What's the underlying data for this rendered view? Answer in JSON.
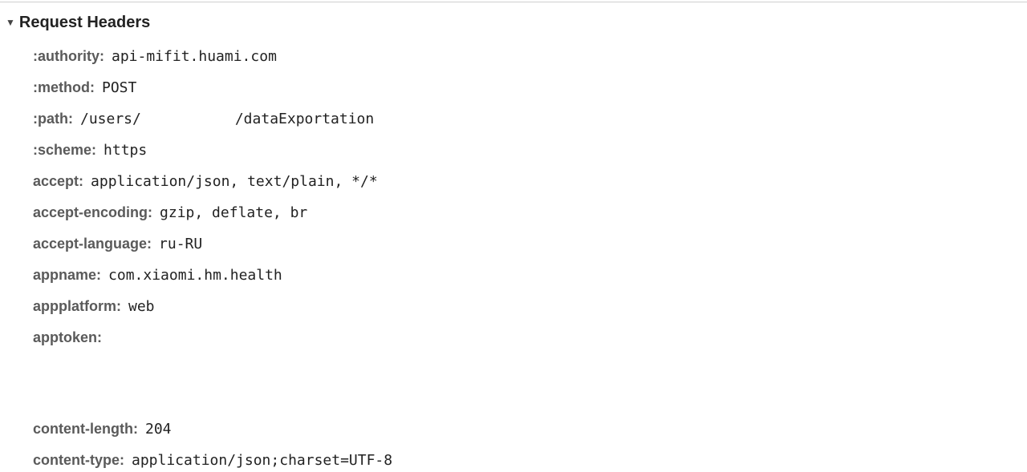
{
  "section": {
    "title": "Request Headers",
    "toggle_icon": "triangle-down-icon",
    "expanded": true
  },
  "headers": [
    {
      "key": ":authority:",
      "value": "api-mifit.huami.com"
    },
    {
      "key": ":method:",
      "value": "POST"
    },
    {
      "key": ":path:",
      "value_prefix": "/users/",
      "value_suffix": "/dataExportation"
    },
    {
      "key": ":scheme:",
      "value": "https"
    },
    {
      "key": "accept:",
      "value": "application/json, text/plain, */*"
    },
    {
      "key": "accept-encoding:",
      "value": "gzip, deflate, br"
    },
    {
      "key": "accept-language:",
      "value": "ru-RU"
    },
    {
      "key": "appname:",
      "value": "com.xiaomi.hm.health"
    },
    {
      "key": "appplatform:",
      "value": "web"
    },
    {
      "key": "apptoken:",
      "value": ""
    },
    {
      "key": "content-length:",
      "value": "204"
    },
    {
      "key": "content-type:",
      "value": "application/json;charset=UTF-8"
    }
  ]
}
